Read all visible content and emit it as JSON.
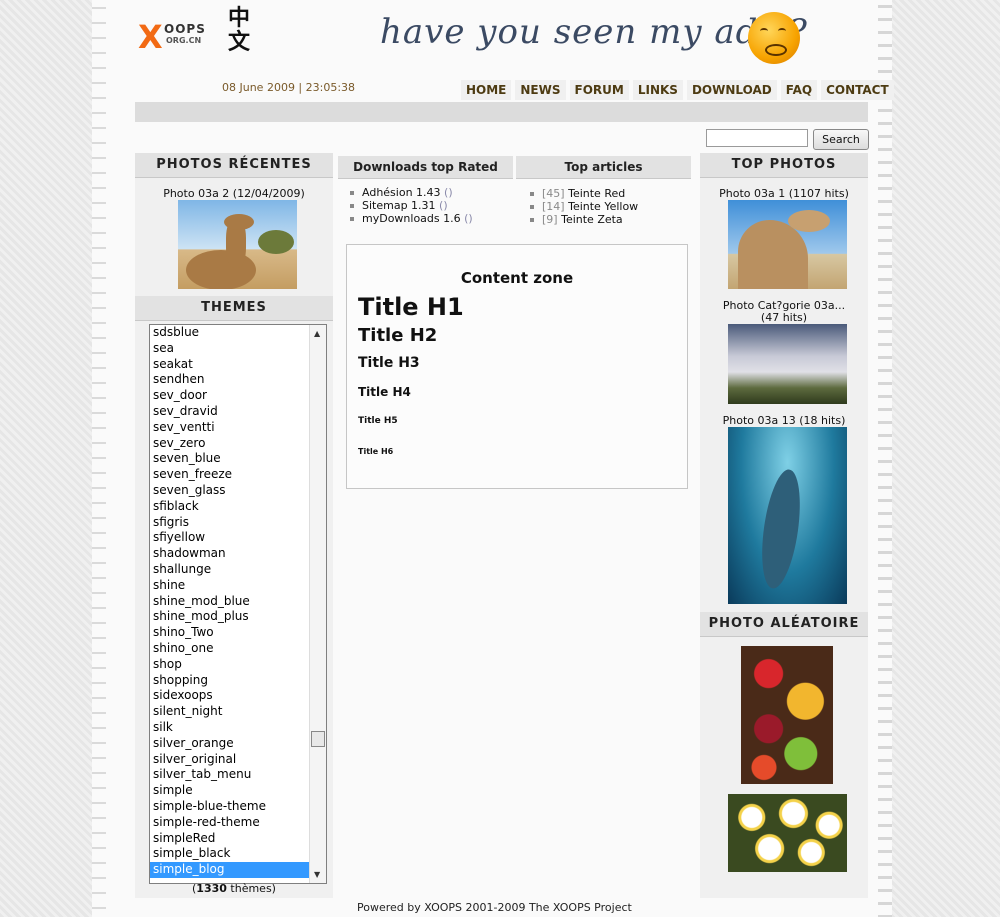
{
  "header": {
    "logo_x": "X",
    "logo_oops": "OOPS",
    "logo_org": "ORG.CN",
    "logo_cn": "中文",
    "banner_text": "have you seen my ads ?",
    "datetime": "08 June 2009 | 23:05:38"
  },
  "nav": [
    "HOME",
    "NEWS",
    "FORUM",
    "LINKS",
    "DOWNLOAD",
    "FAQ",
    "CONTACT"
  ],
  "search": {
    "button_label": "Search",
    "placeholder": ""
  },
  "left": {
    "recent_title": "PHOTOS RÉCENTES",
    "recent_caption": "Photo 03a 2 (12/04/2009)",
    "themes_title": "THEMES",
    "themes": [
      "sdsblue",
      "sea",
      "seakat",
      "sendhen",
      "sev_door",
      "sev_dravid",
      "sev_ventti",
      "sev_zero",
      "seven_blue",
      "seven_freeze",
      "seven_glass",
      "sfiblack",
      "sfigris",
      "sfiyellow",
      "shadowman",
      "shallunge",
      "shine",
      "shine_mod_blue",
      "shine_mod_plus",
      "shino_Two",
      "shino_one",
      "shop",
      "shopping",
      "sidexoops",
      "silent_night",
      "silk",
      "silver_orange",
      "silver_original",
      "silver_tab_menu",
      "simple",
      "simple-blue-theme",
      "simple-red-theme",
      "simpleRed",
      "simple_black",
      "simple_blog"
    ],
    "selected_theme": "simple_blog",
    "theme_count": "1330",
    "theme_count_suffix": " thèmes)",
    "theme_count_prefix": "("
  },
  "middle": {
    "downloads_title": "Downloads top Rated",
    "downloads": [
      {
        "name": "Adhésion 1.43",
        "paren": "()"
      },
      {
        "name": "Sitemap 1.31",
        "paren": "()"
      },
      {
        "name": "myDownloads 1.6",
        "paren": "()"
      }
    ],
    "articles_title": "Top articles",
    "articles": [
      {
        "num": "[45]",
        "name": "Teinte Red"
      },
      {
        "num": "[14]",
        "name": "Teinte Yellow"
      },
      {
        "num": "[9]",
        "name": "Teinte Zeta"
      }
    ],
    "content_title": "Content zone",
    "h1": "Title H1",
    "h2": "Title H2",
    "h3": "Title H3",
    "h4": "Title H4",
    "h5": "Title H5",
    "h6": "Title H6"
  },
  "right": {
    "top_title": "TOP PHOTOS",
    "top_photos": [
      {
        "caption": "Photo 03a 1 (1107 hits)"
      },
      {
        "caption": "Photo Cat?gorie 03a...",
        "caption2": "(47 hits)"
      },
      {
        "caption": "Photo 03a 13 (18 hits)"
      }
    ],
    "random_title": "PHOTO ALÉATOIRE"
  },
  "footer": "Powered by XOOPS 2001-2009 The XOOPS Project"
}
